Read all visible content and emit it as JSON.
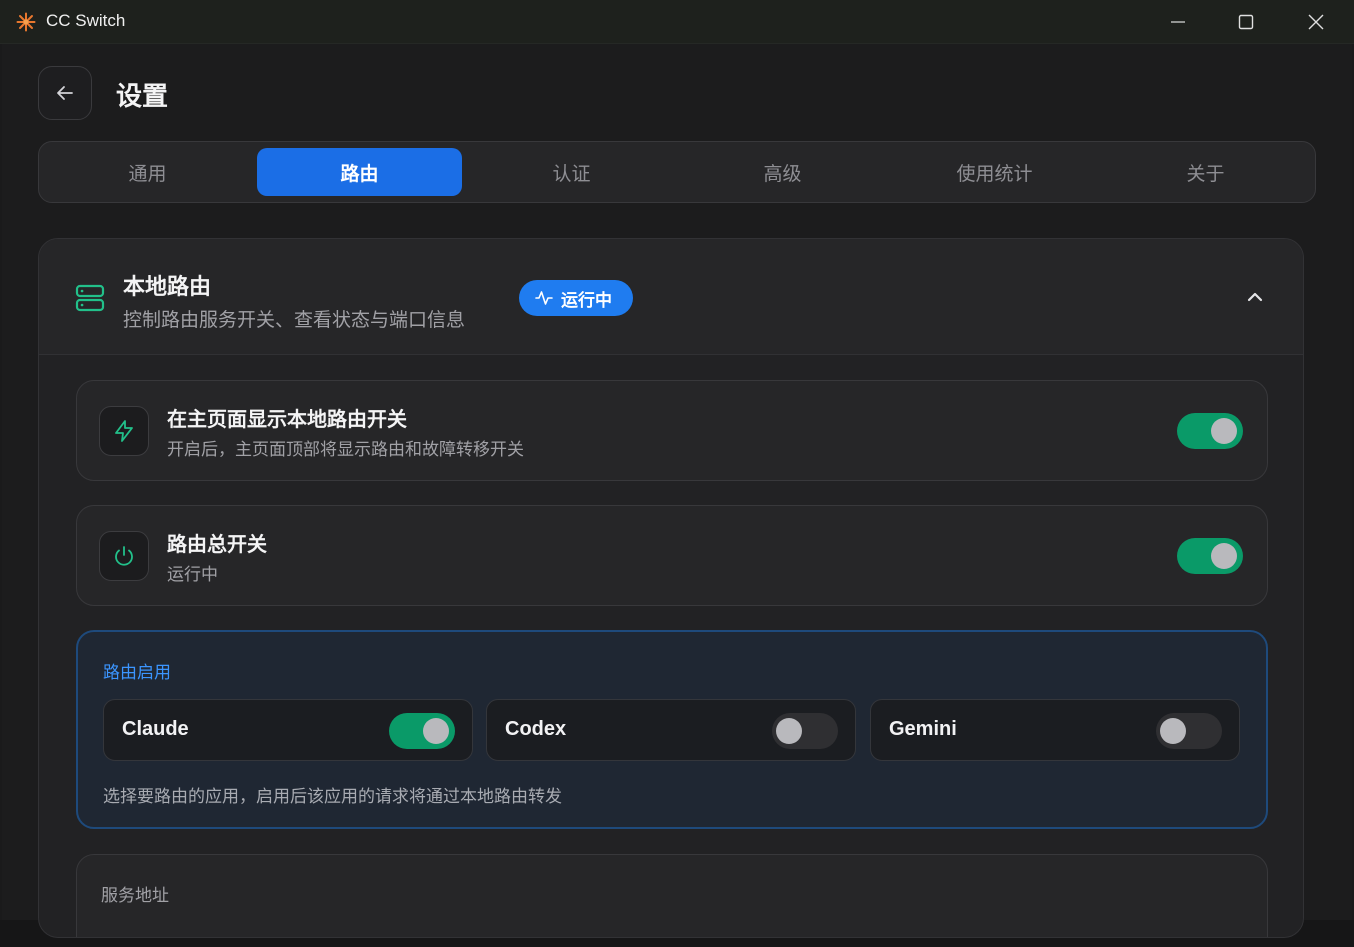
{
  "window": {
    "title": "CC Switch"
  },
  "page": {
    "title": "设置"
  },
  "tabs": [
    {
      "label": "通用",
      "active": false
    },
    {
      "label": "路由",
      "active": true
    },
    {
      "label": "认证",
      "active": false
    },
    {
      "label": "高级",
      "active": false
    },
    {
      "label": "使用统计",
      "active": false
    },
    {
      "label": "关于",
      "active": false
    }
  ],
  "section": {
    "title": "本地路由",
    "subtitle": "控制路由服务开关、查看状态与端口信息",
    "status_badge": "运行中",
    "icon": "server-icon",
    "expanded": true
  },
  "settings": [
    {
      "title": "在主页面显示本地路由开关",
      "description": "开启后，主页面顶部将显示路由和故障转移开关",
      "icon": "zap-icon",
      "enabled": true
    },
    {
      "title": "路由总开关",
      "description": "运行中",
      "icon": "power-icon",
      "enabled": true
    }
  ],
  "routing": {
    "label": "路由启用",
    "apps": [
      {
        "name": "Claude",
        "enabled": true
      },
      {
        "name": "Codex",
        "enabled": false
      },
      {
        "name": "Gemini",
        "enabled": false
      }
    ],
    "note": "选择要路由的应用，启用后该应用的请求将通过本地路由转发"
  },
  "service": {
    "label": "服务地址"
  },
  "colors": {
    "accent": "#1b6ee6",
    "toggle_on": "#0a9a68",
    "route_label": "#3b95ff",
    "icon_green": "#22c08a"
  }
}
